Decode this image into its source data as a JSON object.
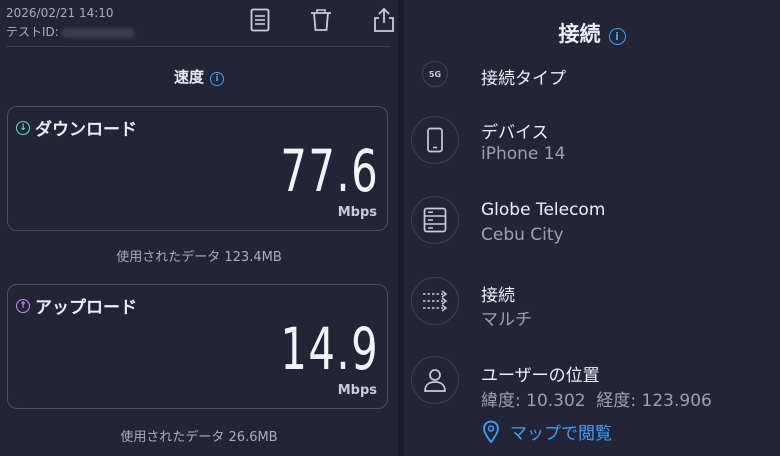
{
  "header": {
    "date": "2026/02/21 14:10",
    "test_id_label": "テストID:"
  },
  "toolbar": {
    "icons": [
      "document-icon",
      "trash-icon",
      "share-icon"
    ]
  },
  "speed": {
    "title": "速度",
    "download": {
      "label": "ダウンロード",
      "value": "77.6",
      "unit": "Mbps",
      "used": "使用されたデータ 123.4MB"
    },
    "upload": {
      "label": "アップロード",
      "value": "14.9",
      "unit": "Mbps",
      "used": "使用されたデータ 26.6MB"
    }
  },
  "connection": {
    "title": "接続",
    "type": {
      "badge": "5G",
      "label": "接続タイプ"
    },
    "device": {
      "label": "デバイス",
      "value": "iPhone 14"
    },
    "server": {
      "label": "Globe Telecom",
      "value": "Cebu City"
    },
    "connections": {
      "label": "接続",
      "value": "マルチ"
    },
    "location": {
      "label": "ユーザーの位置",
      "value": "緯度: 10.302  経度: 123.906",
      "map_link": "マップで閲覧"
    }
  },
  "colors": {
    "background": "#232536",
    "accent_blue": "#3aa0ff",
    "download_teal": "#5fe0d2",
    "upload_purple": "#c38cff"
  }
}
